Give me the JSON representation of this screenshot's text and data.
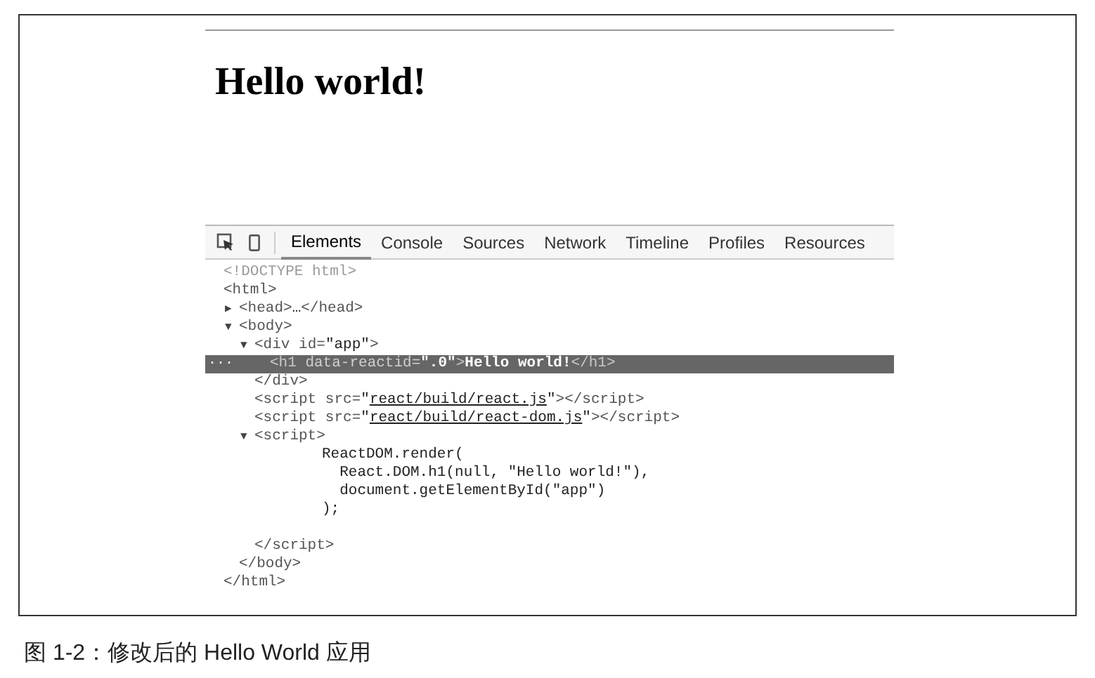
{
  "page": {
    "heading": "Hello world!"
  },
  "devtools": {
    "tabs": [
      {
        "label": "Elements",
        "selected": true
      },
      {
        "label": "Console",
        "selected": false
      },
      {
        "label": "Sources",
        "selected": false
      },
      {
        "label": "Network",
        "selected": false
      },
      {
        "label": "Timeline",
        "selected": false
      },
      {
        "label": "Profiles",
        "selected": false
      },
      {
        "label": "Resources",
        "selected": false
      }
    ],
    "selected_row_marker": "...",
    "tree": [
      {
        "kind": "element",
        "selected": false,
        "segments": [
          {
            "kind": "doctype",
            "text": "<!DOCTYPE html>"
          }
        ]
      },
      {
        "kind": "element",
        "selected": false,
        "segments": [
          {
            "kind": "tag",
            "text": "<html>"
          }
        ],
        "close": [
          {
            "kind": "tag",
            "text": "</html>"
          }
        ],
        "children": [
          {
            "kind": "element",
            "selected": false,
            "toggle": "▶",
            "segments": [
              {
                "kind": "tag",
                "text": "<head>"
              },
              {
                "kind": "text",
                "text": "…"
              },
              {
                "kind": "tag",
                "text": "</head>"
              }
            ]
          },
          {
            "kind": "element",
            "selected": false,
            "toggle": "▼",
            "segments": [
              {
                "kind": "tag",
                "text": "<body>"
              }
            ],
            "close": [
              {
                "kind": "tag",
                "text": "</body>"
              }
            ],
            "children": [
              {
                "kind": "element",
                "selected": false,
                "toggle": "▼",
                "segments": [
                  {
                    "kind": "tag",
                    "text": "<div"
                  },
                  {
                    "kind": "attr",
                    "text": " id="
                  },
                  {
                    "kind": "value",
                    "text": "\"app\""
                  },
                  {
                    "kind": "tag",
                    "text": ">"
                  }
                ],
                "close": [
                  {
                    "kind": "tag",
                    "text": "</div>"
                  }
                ],
                "children": [
                  {
                    "kind": "element",
                    "selected": true,
                    "segments": [
                      {
                        "kind": "tag",
                        "text": "<h1"
                      },
                      {
                        "kind": "attr",
                        "text": " data-reactid="
                      },
                      {
                        "kind": "value",
                        "text": "\".0\""
                      },
                      {
                        "kind": "tag",
                        "text": ">"
                      },
                      {
                        "kind": "text",
                        "text": "Hello world!"
                      },
                      {
                        "kind": "tag",
                        "text": "</h1>"
                      }
                    ]
                  }
                ]
              },
              {
                "kind": "element",
                "selected": false,
                "segments": [
                  {
                    "kind": "tag",
                    "text": "<script"
                  },
                  {
                    "kind": "attr",
                    "text": " src="
                  },
                  {
                    "kind": "value",
                    "text": "\""
                  },
                  {
                    "kind": "link",
                    "text": "react/build/react.js"
                  },
                  {
                    "kind": "value",
                    "text": "\""
                  },
                  {
                    "kind": "tag",
                    "text": "></script>"
                  }
                ]
              },
              {
                "kind": "element",
                "selected": false,
                "segments": [
                  {
                    "kind": "tag",
                    "text": "<script"
                  },
                  {
                    "kind": "attr",
                    "text": " src="
                  },
                  {
                    "kind": "value",
                    "text": "\""
                  },
                  {
                    "kind": "link",
                    "text": "react/build/react-dom.js"
                  },
                  {
                    "kind": "value",
                    "text": "\""
                  },
                  {
                    "kind": "tag",
                    "text": "></script>"
                  }
                ]
              },
              {
                "kind": "element",
                "selected": false,
                "toggle": "▼",
                "segments": [
                  {
                    "kind": "tag",
                    "text": "<script>"
                  }
                ],
                "close": [
                  {
                    "kind": "tag",
                    "text": "</script>"
                  }
                ],
                "children": [
                  {
                    "kind": "code",
                    "selected": false,
                    "lines": [
                      "ReactDOM.render(",
                      "  React.DOM.h1(null, \"Hello world!\"),",
                      "  document.getElementById(\"app\")",
                      ");"
                    ]
                  }
                ]
              }
            ]
          }
        ]
      }
    ]
  },
  "caption": "图 1-2：修改后的 Hello World 应用"
}
